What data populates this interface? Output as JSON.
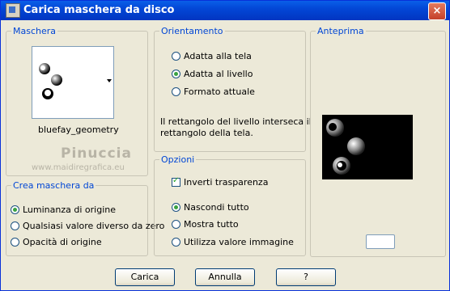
{
  "window": {
    "title": "Carica maschera da disco",
    "close_glyph": "×"
  },
  "mask_group": {
    "label": "Maschera",
    "selected_mask": "bluefay_geometry",
    "dropdown_icon": "triangle-down-icon"
  },
  "watermark": {
    "line1": "Pinuccia",
    "line2": "www.maidiregrafica.eu"
  },
  "source_group": {
    "label": "Crea maschera da",
    "options": [
      {
        "label": "Luminanza di origine",
        "selected": true
      },
      {
        "label": "Qualsiasi valore diverso da zero",
        "selected": false
      },
      {
        "label": "Opacità di origine",
        "selected": false
      }
    ]
  },
  "orientation_group": {
    "label": "Orientamento",
    "options": [
      {
        "label": "Adatta alla tela",
        "selected": false
      },
      {
        "label": "Adatta al livello",
        "selected": true
      },
      {
        "label": "Formato attuale",
        "selected": false
      }
    ],
    "description_line1": "Il rettangolo del livello interseca il",
    "description_line2": "rettangolo della tela."
  },
  "options_group": {
    "label": "Opzioni",
    "invert_label": "Inverti trasparenza",
    "invert_checked": true,
    "visibility_options": [
      {
        "label": "Nascondi tutto",
        "selected": true
      },
      {
        "label": "Mostra tutto",
        "selected": false
      },
      {
        "label": "Utilizza valore immagine",
        "selected": false
      }
    ]
  },
  "preview_group": {
    "label": "Anteprima"
  },
  "buttons": {
    "load": "Carica",
    "cancel": "Annulla",
    "help": "?"
  },
  "colors": {
    "title_bar": "#0347d6",
    "group_label": "#0046d5",
    "dialog_bg": "#ece9d8"
  }
}
